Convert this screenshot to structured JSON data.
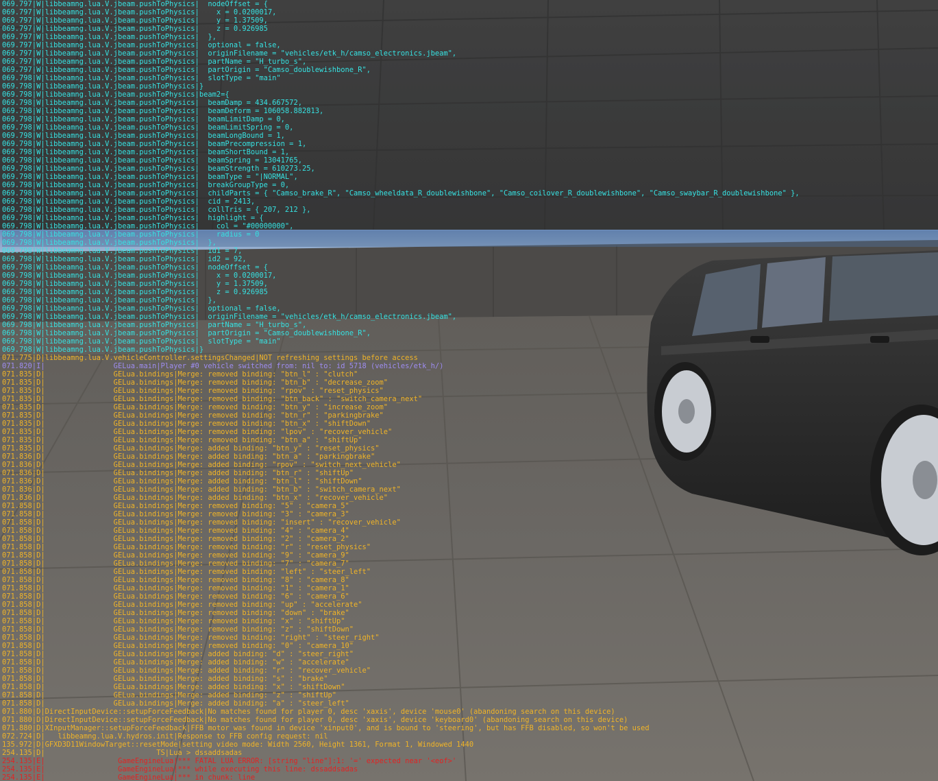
{
  "theme": {
    "warning_color": "#36e2e2",
    "debug_color": "#f0b428",
    "info_color": "#9e8cf0",
    "error_color": "#e02424",
    "highlight_color": "#506e96"
  },
  "console": {
    "lines": [
      {
        "ts": "069.797",
        "lv": "W",
        "src": "libbeamng.lua.V.jbeam.pushToPhysics",
        "msg": "  nodeOffset = {"
      },
      {
        "ts": "069.797",
        "lv": "W",
        "src": "libbeamng.lua.V.jbeam.pushToPhysics",
        "msg": "    x = 0.0200017,"
      },
      {
        "ts": "069.797",
        "lv": "W",
        "src": "libbeamng.lua.V.jbeam.pushToPhysics",
        "msg": "    y = 1.37509,"
      },
      {
        "ts": "069.797",
        "lv": "W",
        "src": "libbeamng.lua.V.jbeam.pushToPhysics",
        "msg": "    z = 0.926985"
      },
      {
        "ts": "069.797",
        "lv": "W",
        "src": "libbeamng.lua.V.jbeam.pushToPhysics",
        "msg": "  },"
      },
      {
        "ts": "069.797",
        "lv": "W",
        "src": "libbeamng.lua.V.jbeam.pushToPhysics",
        "msg": "  optional = false,"
      },
      {
        "ts": "069.797",
        "lv": "W",
        "src": "libbeamng.lua.V.jbeam.pushToPhysics",
        "msg": "  originFilename = \"vehicles/etk_h/camso_electronics.jbeam\","
      },
      {
        "ts": "069.797",
        "lv": "W",
        "src": "libbeamng.lua.V.jbeam.pushToPhysics",
        "msg": "  partName = \"H_turbo_s\","
      },
      {
        "ts": "069.797",
        "lv": "W",
        "src": "libbeamng.lua.V.jbeam.pushToPhysics",
        "msg": "  partOrigin = \"Camso_doublewishbone_R\","
      },
      {
        "ts": "069.798",
        "lv": "W",
        "src": "libbeamng.lua.V.jbeam.pushToPhysics",
        "msg": "  slotType = \"main\""
      },
      {
        "ts": "069.798",
        "lv": "W",
        "src": "libbeamng.lua.V.jbeam.pushToPhysics",
        "msg": "}"
      },
      {
        "ts": "069.798",
        "lv": "W",
        "src": "libbeamng.lua.V.jbeam.pushToPhysics",
        "msg": "beam2={"
      },
      {
        "ts": "069.798",
        "lv": "W",
        "src": "libbeamng.lua.V.jbeam.pushToPhysics",
        "msg": "  beamDamp = 434.667572,"
      },
      {
        "ts": "069.798",
        "lv": "W",
        "src": "libbeamng.lua.V.jbeam.pushToPhysics",
        "msg": "  beamDeform = 106058.882813,"
      },
      {
        "ts": "069.798",
        "lv": "W",
        "src": "libbeamng.lua.V.jbeam.pushToPhysics",
        "msg": "  beamLimitDamp = 0,"
      },
      {
        "ts": "069.798",
        "lv": "W",
        "src": "libbeamng.lua.V.jbeam.pushToPhysics",
        "msg": "  beamLimitSpring = 0,"
      },
      {
        "ts": "069.798",
        "lv": "W",
        "src": "libbeamng.lua.V.jbeam.pushToPhysics",
        "msg": "  beamLongBound = 1,"
      },
      {
        "ts": "069.798",
        "lv": "W",
        "src": "libbeamng.lua.V.jbeam.pushToPhysics",
        "msg": "  beamPrecompression = 1,"
      },
      {
        "ts": "069.798",
        "lv": "W",
        "src": "libbeamng.lua.V.jbeam.pushToPhysics",
        "msg": "  beamShortBound = 1,"
      },
      {
        "ts": "069.798",
        "lv": "W",
        "src": "libbeamng.lua.V.jbeam.pushToPhysics",
        "msg": "  beamSpring = 13041765,"
      },
      {
        "ts": "069.798",
        "lv": "W",
        "src": "libbeamng.lua.V.jbeam.pushToPhysics",
        "msg": "  beamStrength = 610273.25,"
      },
      {
        "ts": "069.798",
        "lv": "W",
        "src": "libbeamng.lua.V.jbeam.pushToPhysics",
        "msg": "  beamType = \"|NORMAL\","
      },
      {
        "ts": "069.798",
        "lv": "W",
        "src": "libbeamng.lua.V.jbeam.pushToPhysics",
        "msg": "  breakGroupType = 0,"
      },
      {
        "ts": "069.798",
        "lv": "W",
        "src": "libbeamng.lua.V.jbeam.pushToPhysics",
        "msg": "  childParts = { \"Camso_brake_R\", \"Camso_wheeldata_R_doublewishbone\", \"Camso_coilover_R_doublewishbone\", \"Camso_swaybar_R_doublewishbone\" },"
      },
      {
        "ts": "069.798",
        "lv": "W",
        "src": "libbeamng.lua.V.jbeam.pushToPhysics",
        "msg": "  cid = 2413,"
      },
      {
        "ts": "069.798",
        "lv": "W",
        "src": "libbeamng.lua.V.jbeam.pushToPhysics",
        "msg": "  collTris = { 207, 212 },"
      },
      {
        "ts": "069.798",
        "lv": "W",
        "src": "libbeamng.lua.V.jbeam.pushToPhysics",
        "msg": "  highlight = {"
      },
      {
        "ts": "069.798",
        "lv": "W",
        "src": "libbeamng.lua.V.jbeam.pushToPhysics",
        "msg": "    col = \"#00000000\","
      },
      {
        "ts": "069.798",
        "lv": "W",
        "src": "libbeamng.lua.V.jbeam.pushToPhysics",
        "msg": "    radius = 0",
        "hl": true
      },
      {
        "ts": "069.798",
        "lv": "W",
        "src": "libbeamng.lua.V.jbeam.pushToPhysics",
        "msg": "  },",
        "hl": true
      },
      {
        "ts": "069.798",
        "lv": "W",
        "src": "libbeamng.lua.V.jbeam.pushToPhysics",
        "msg": "  id1 = 7,"
      },
      {
        "ts": "069.798",
        "lv": "W",
        "src": "libbeamng.lua.V.jbeam.pushToPhysics",
        "msg": "  id2 = 92,"
      },
      {
        "ts": "069.798",
        "lv": "W",
        "src": "libbeamng.lua.V.jbeam.pushToPhysics",
        "msg": "  nodeOffset = {"
      },
      {
        "ts": "069.798",
        "lv": "W",
        "src": "libbeamng.lua.V.jbeam.pushToPhysics",
        "msg": "    x = 0.0200017,"
      },
      {
        "ts": "069.798",
        "lv": "W",
        "src": "libbeamng.lua.V.jbeam.pushToPhysics",
        "msg": "    y = 1.37509,"
      },
      {
        "ts": "069.798",
        "lv": "W",
        "src": "libbeamng.lua.V.jbeam.pushToPhysics",
        "msg": "    z = 0.926985"
      },
      {
        "ts": "069.798",
        "lv": "W",
        "src": "libbeamng.lua.V.jbeam.pushToPhysics",
        "msg": "  },"
      },
      {
        "ts": "069.798",
        "lv": "W",
        "src": "libbeamng.lua.V.jbeam.pushToPhysics",
        "msg": "  optional = false,"
      },
      {
        "ts": "069.798",
        "lv": "W",
        "src": "libbeamng.lua.V.jbeam.pushToPhysics",
        "msg": "  originFilename = \"vehicles/etk_h/camso_electronics.jbeam\","
      },
      {
        "ts": "069.798",
        "lv": "W",
        "src": "libbeamng.lua.V.jbeam.pushToPhysics",
        "msg": "  partName = \"H_turbo_s\","
      },
      {
        "ts": "069.798",
        "lv": "W",
        "src": "libbeamng.lua.V.jbeam.pushToPhysics",
        "msg": "  partOrigin = \"Camso_doublewishbone_R\","
      },
      {
        "ts": "069.798",
        "lv": "W",
        "src": "libbeamng.lua.V.jbeam.pushToPhysics",
        "msg": "  slotType = \"main\""
      },
      {
        "ts": "069.798",
        "lv": "W",
        "src": "libbeamng.lua.V.jbeam.pushToPhysics",
        "msg": "}"
      },
      {
        "ts": "071.775",
        "lv": "D",
        "src": "libbeamng.lua.V.vehicleController.settingsChanged",
        "msg": "NOT refreshing settings before access"
      },
      {
        "ts": "071.820",
        "lv": "I",
        "src": "                GELua.main",
        "msg": "Player #0 vehicle switched from: nil to: id 5718 (vehicles/etk_h/)"
      },
      {
        "ts": "071.835",
        "lv": "D",
        "src": "                GELua.bindings",
        "msg": "Merge: removed binding: \"btn_l\" : \"clutch\""
      },
      {
        "ts": "071.835",
        "lv": "D",
        "src": "                GELua.bindings",
        "msg": "Merge: removed binding: \"btn_b\" : \"decrease_zoom\""
      },
      {
        "ts": "071.835",
        "lv": "D",
        "src": "                GELua.bindings",
        "msg": "Merge: removed binding: \"rpov\" : \"reset_physics\""
      },
      {
        "ts": "071.835",
        "lv": "D",
        "src": "                GELua.bindings",
        "msg": "Merge: removed binding: \"btn_back\" : \"switch_camera_next\""
      },
      {
        "ts": "071.835",
        "lv": "D",
        "src": "                GELua.bindings",
        "msg": "Merge: removed binding: \"btn_y\" : \"increase_zoom\""
      },
      {
        "ts": "071.835",
        "lv": "D",
        "src": "                GELua.bindings",
        "msg": "Merge: removed binding: \"btn_r\" : \"parkingbrake\""
      },
      {
        "ts": "071.835",
        "lv": "D",
        "src": "                GELua.bindings",
        "msg": "Merge: removed binding: \"btn_x\" : \"shiftDown\""
      },
      {
        "ts": "071.835",
        "lv": "D",
        "src": "                GELua.bindings",
        "msg": "Merge: removed binding: \"lpov\" : \"recover_vehicle\""
      },
      {
        "ts": "071.835",
        "lv": "D",
        "src": "                GELua.bindings",
        "msg": "Merge: removed binding: \"btn_a\" : \"shiftUp\""
      },
      {
        "ts": "071.835",
        "lv": "D",
        "src": "                GELua.bindings",
        "msg": "Merge: added binding: \"btn_y\" : \"reset_physics\""
      },
      {
        "ts": "071.836",
        "lv": "D",
        "src": "                GELua.bindings",
        "msg": "Merge: added binding: \"btn_a\" : \"parkingbrake\""
      },
      {
        "ts": "071.836",
        "lv": "D",
        "src": "                GELua.bindings",
        "msg": "Merge: added binding: \"rpov\" : \"switch_next_vehicle\""
      },
      {
        "ts": "071.836",
        "lv": "D",
        "src": "                GELua.bindings",
        "msg": "Merge: added binding: \"btn_r\" : \"shiftUp\""
      },
      {
        "ts": "071.836",
        "lv": "D",
        "src": "                GELua.bindings",
        "msg": "Merge: added binding: \"btn_l\" : \"shiftDown\""
      },
      {
        "ts": "071.836",
        "lv": "D",
        "src": "                GELua.bindings",
        "msg": "Merge: added binding: \"btn_b\" : \"switch_camera_next\""
      },
      {
        "ts": "071.836",
        "lv": "D",
        "src": "                GELua.bindings",
        "msg": "Merge: added binding: \"btn_x\" : \"recover_vehicle\""
      },
      {
        "ts": "071.858",
        "lv": "D",
        "src": "                GELua.bindings",
        "msg": "Merge: removed binding: \"5\" : \"camera_5\""
      },
      {
        "ts": "071.858",
        "lv": "D",
        "src": "                GELua.bindings",
        "msg": "Merge: removed binding: \"3\" : \"camera_3\""
      },
      {
        "ts": "071.858",
        "lv": "D",
        "src": "                GELua.bindings",
        "msg": "Merge: removed binding: \"insert\" : \"recover_vehicle\""
      },
      {
        "ts": "071.858",
        "lv": "D",
        "src": "                GELua.bindings",
        "msg": "Merge: removed binding: \"4\" : \"camera_4\""
      },
      {
        "ts": "071.858",
        "lv": "D",
        "src": "                GELua.bindings",
        "msg": "Merge: removed binding: \"2\" : \"camera_2\""
      },
      {
        "ts": "071.858",
        "lv": "D",
        "src": "                GELua.bindings",
        "msg": "Merge: removed binding: \"r\" : \"reset_physics\""
      },
      {
        "ts": "071.858",
        "lv": "D",
        "src": "                GELua.bindings",
        "msg": "Merge: removed binding: \"9\" : \"camera_9\""
      },
      {
        "ts": "071.858",
        "lv": "D",
        "src": "                GELua.bindings",
        "msg": "Merge: removed binding: \"7\" : \"camera_7\""
      },
      {
        "ts": "071.858",
        "lv": "D",
        "src": "                GELua.bindings",
        "msg": "Merge: removed binding: \"left\" : \"steer_left\""
      },
      {
        "ts": "071.858",
        "lv": "D",
        "src": "                GELua.bindings",
        "msg": "Merge: removed binding: \"8\" : \"camera_8\""
      },
      {
        "ts": "071.858",
        "lv": "D",
        "src": "                GELua.bindings",
        "msg": "Merge: removed binding: \"1\" : \"camera_1\""
      },
      {
        "ts": "071.858",
        "lv": "D",
        "src": "                GELua.bindings",
        "msg": "Merge: removed binding: \"6\" : \"camera_6\""
      },
      {
        "ts": "071.858",
        "lv": "D",
        "src": "                GELua.bindings",
        "msg": "Merge: removed binding: \"up\" : \"accelerate\""
      },
      {
        "ts": "071.858",
        "lv": "D",
        "src": "                GELua.bindings",
        "msg": "Merge: removed binding: \"down\" : \"brake\""
      },
      {
        "ts": "071.858",
        "lv": "D",
        "src": "                GELua.bindings",
        "msg": "Merge: removed binding: \"x\" : \"shiftUp\""
      },
      {
        "ts": "071.858",
        "lv": "D",
        "src": "                GELua.bindings",
        "msg": "Merge: removed binding: \"z\" : \"shiftDown\""
      },
      {
        "ts": "071.858",
        "lv": "D",
        "src": "                GELua.bindings",
        "msg": "Merge: removed binding: \"right\" : \"steer_right\""
      },
      {
        "ts": "071.858",
        "lv": "D",
        "src": "                GELua.bindings",
        "msg": "Merge: removed binding: \"0\" : \"camera_10\""
      },
      {
        "ts": "071.858",
        "lv": "D",
        "src": "                GELua.bindings",
        "msg": "Merge: added binding: \"d\" : \"steer_right\""
      },
      {
        "ts": "071.858",
        "lv": "D",
        "src": "                GELua.bindings",
        "msg": "Merge: added binding: \"w\" : \"accelerate\""
      },
      {
        "ts": "071.858",
        "lv": "D",
        "src": "                GELua.bindings",
        "msg": "Merge: added binding: \"r\" : \"recover_vehicle\""
      },
      {
        "ts": "071.858",
        "lv": "D",
        "src": "                GELua.bindings",
        "msg": "Merge: added binding: \"s\" : \"brake\""
      },
      {
        "ts": "071.858",
        "lv": "D",
        "src": "                GELua.bindings",
        "msg": "Merge: added binding: \"x\" : \"shiftDown\""
      },
      {
        "ts": "071.858",
        "lv": "D",
        "src": "                GELua.bindings",
        "msg": "Merge: added binding: \"z\" : \"shiftUp\""
      },
      {
        "ts": "071.858",
        "lv": "D",
        "src": "                GELua.bindings",
        "msg": "Merge: added binding: \"a\" : \"steer_left\""
      },
      {
        "ts": "071.880",
        "lv": "D",
        "src": "DirectInputDevice::setupForceFeedback",
        "msg": "No matches found for player 0, desc 'xaxis', device 'mouse0' (abandoning search on this device)"
      },
      {
        "ts": "071.880",
        "lv": "D",
        "src": "DirectInputDevice::setupForceFeedback",
        "msg": "No matches found for player 0, desc 'xaxis', device 'keyboard0' (abandoning search on this device)"
      },
      {
        "ts": "071.880",
        "lv": "D",
        "src": "XInputManager::setupForceFeedback",
        "msg": "FFB motor was found in device 'xinput0', and is bound to 'steering', but has FFB disabled, so won't be used"
      },
      {
        "ts": "072.724",
        "lv": "D",
        "src": "   libbeamng.lua.V.hydros.init",
        "msg": "Response to FFB config request: nil"
      },
      {
        "ts": "135.972",
        "lv": "D",
        "src": "GFXD3D11WindowTarget::resetMode",
        "msg": "setting video mode: Width 2560, Height 1361, Format 1, Windowed 1440"
      },
      {
        "ts": "254.135",
        "lv": "D",
        "src": "                          TS",
        "msg": "Lua > dssaddsadas"
      },
      {
        "ts": "254.135",
        "lv": "E",
        "src": "                 GameEngineLua",
        "msg": "*** FATAL LUA ERROR: [string \"line\"]:1: '=' expected near '<eof>'"
      },
      {
        "ts": "254.135",
        "lv": "E",
        "src": "                 GameEngineLua",
        "msg": "*** while executing this line: dssaddsadas"
      },
      {
        "ts": "254.135",
        "lv": "E",
        "src": "                 GameEngineLua",
        "msg": "*** in chunk: line"
      }
    ]
  }
}
